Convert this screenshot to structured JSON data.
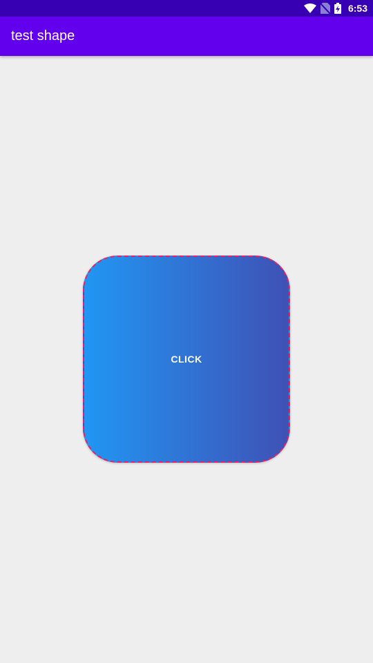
{
  "status_bar": {
    "time": "6:53",
    "icons": [
      "wifi-icon",
      "no-sim-icon",
      "battery-charging-icon"
    ],
    "color": "#3700b3"
  },
  "app_bar": {
    "title": "test shape",
    "color": "#6200ee"
  },
  "main": {
    "button": {
      "label": "CLICK",
      "gradient_start": "#2196f3",
      "gradient_end": "#3f51b5",
      "border_color": "#e91e63"
    },
    "background": "#eeeeee"
  }
}
